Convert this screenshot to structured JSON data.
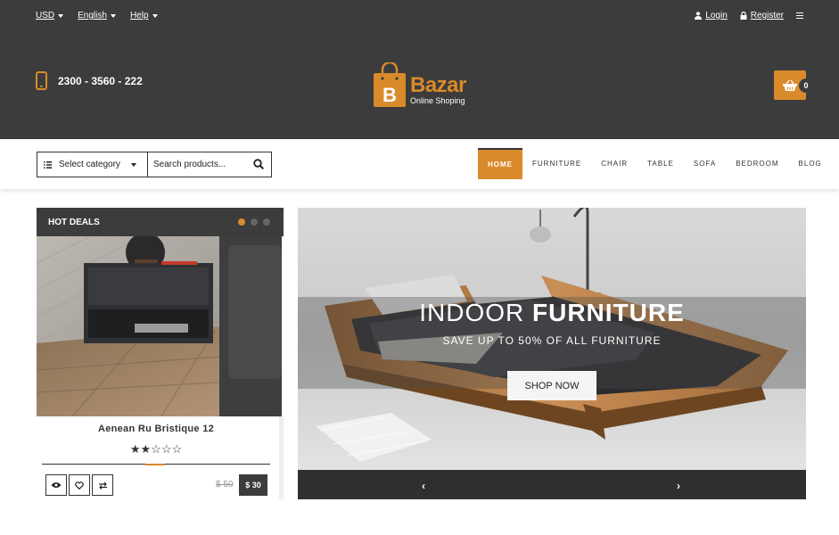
{
  "topbar": {
    "currency": "USD",
    "language": "English",
    "help": "Help",
    "login": "Login",
    "register": "Register"
  },
  "header": {
    "phone": "2300 - 3560 - 222",
    "logo_name": "Bazar",
    "logo_tagline": "Online Shoping",
    "logo_letter": "B",
    "cart_count": "0"
  },
  "search": {
    "category_label": "Select category",
    "placeholder": "Search products..."
  },
  "nav": {
    "items": [
      "HOME",
      "FURNITURE",
      "CHAIR",
      "TABLE",
      "SOFA",
      "BEDROOM",
      "BLOG"
    ],
    "active_index": 0
  },
  "deals": {
    "heading": "HOT DEALS",
    "product_name": "Aenean Ru Bristique 12",
    "rating": 2,
    "rating_max": 5,
    "old_price": "$ 50",
    "new_price": "$ 30"
  },
  "hero": {
    "title_light": "INDOOR",
    "title_bold": "FURNITURE",
    "subtitle": "SAVE UP TO 50% OF ALL FURNITURE",
    "button": "SHOP NOW",
    "prev": "‹",
    "next": "›"
  },
  "colors": {
    "accent": "#d98b2b",
    "dark": "#3c3c3c"
  }
}
